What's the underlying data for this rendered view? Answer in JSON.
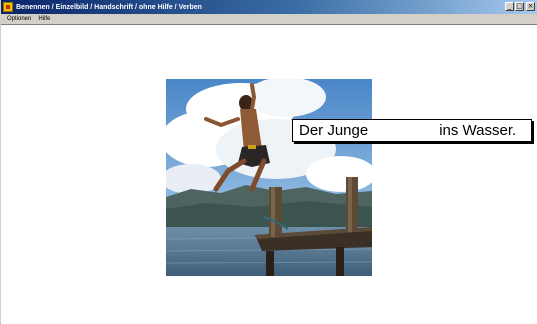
{
  "window": {
    "title": "Benennen / Einzelbild / Handschrift / ohne Hilfe / Verben",
    "buttons": {
      "minimize_glyph": "_",
      "maximize_glyph": "□",
      "close_glyph": "×"
    }
  },
  "menu": {
    "items": [
      "Optionen",
      "Hilfe"
    ]
  },
  "exercise": {
    "image_icon": "boy-jumping-into-water-photo",
    "sentence_start": "Der Junge",
    "blank_value": "",
    "sentence_end": "ins Wasser."
  }
}
